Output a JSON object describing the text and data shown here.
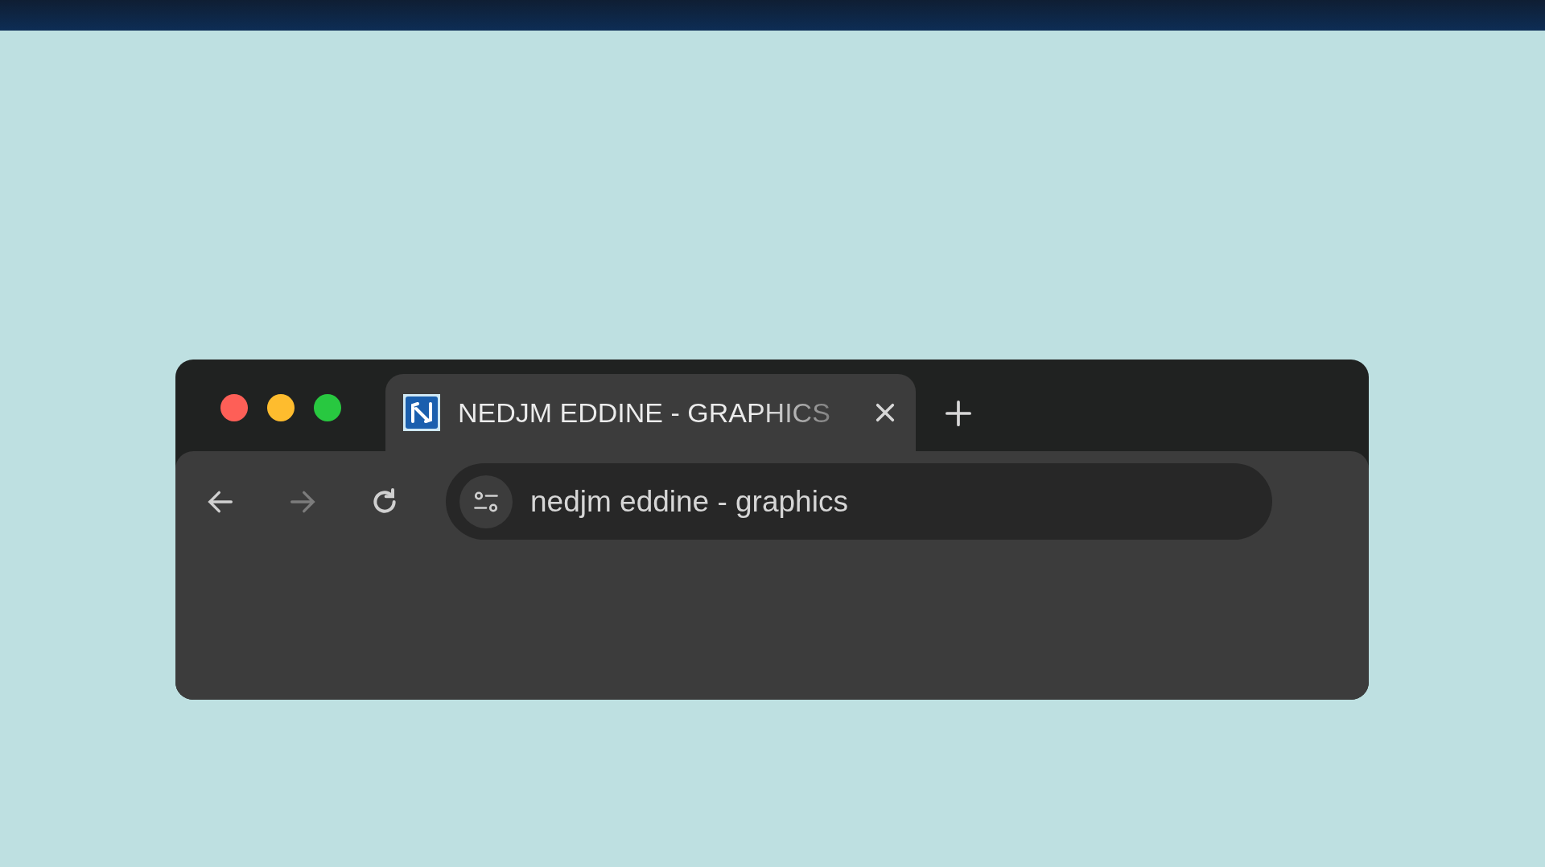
{
  "window": {
    "tabs": [
      {
        "title": "NEDJM EDDINE - GRAPHICS",
        "selected": true
      }
    ]
  },
  "toolbar": {
    "nav_buttons": [
      {
        "kind": "back",
        "disabled": false
      },
      {
        "kind": "forward",
        "disabled": true
      },
      {
        "kind": "reload",
        "disabled": false
      }
    ],
    "address": {
      "value": "nedjm eddine - graphics"
    }
  }
}
